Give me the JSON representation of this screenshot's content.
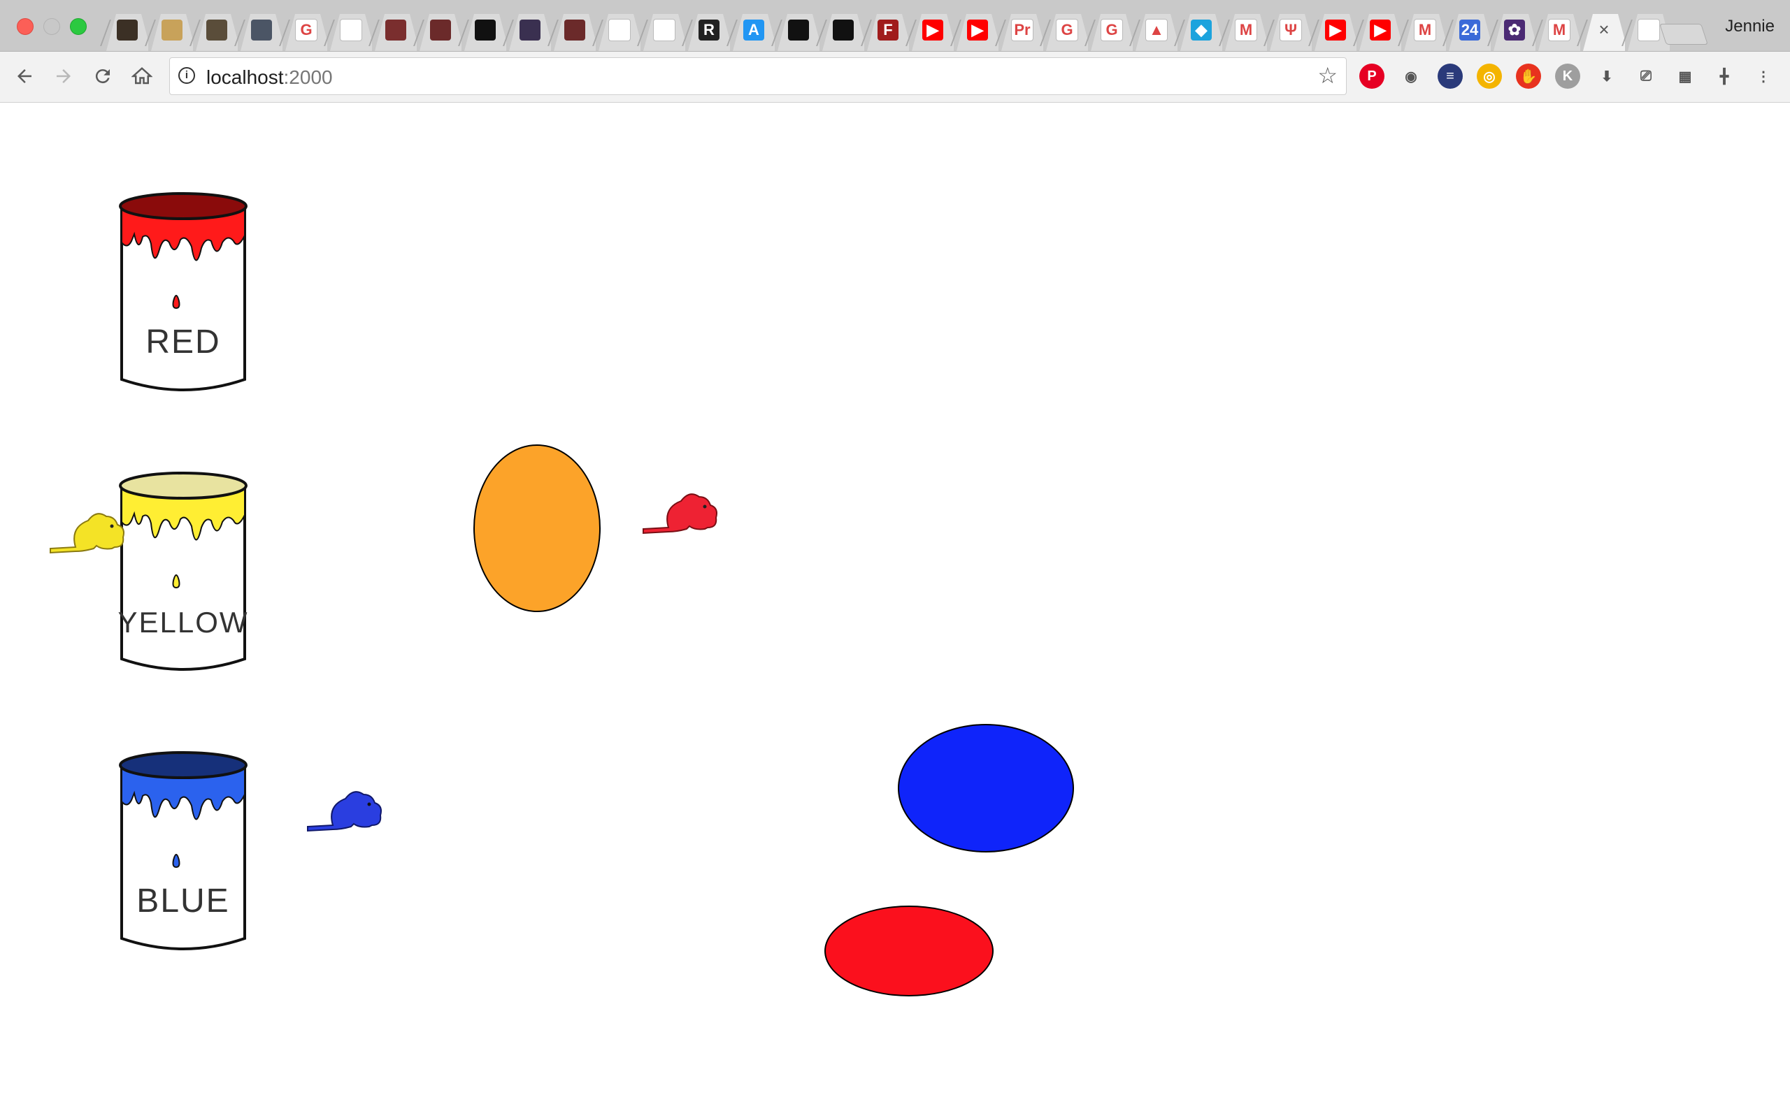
{
  "window": {
    "profile_name": "Jennie",
    "tabs": [
      {
        "icon": "dark-painting-favicon",
        "color": "#3b3025",
        "glyph": ""
      },
      {
        "icon": "feather-favicon",
        "color": "#c8a25a",
        "glyph": ""
      },
      {
        "icon": "painting-favicon",
        "color": "#5a4d3a",
        "glyph": ""
      },
      {
        "icon": "painting-favicon",
        "color": "#4b5565",
        "glyph": ""
      },
      {
        "icon": "google-icon",
        "color": "#ffffff",
        "glyph": "G"
      },
      {
        "icon": "document-icon",
        "color": "#ffffff",
        "glyph": ""
      },
      {
        "icon": "video-thumbnail-favicon",
        "color": "#7a2e2e",
        "glyph": ""
      },
      {
        "icon": "video-thumbnail-favicon",
        "color": "#6b2a2a",
        "glyph": ""
      },
      {
        "icon": "dark-image-favicon",
        "color": "#111111",
        "glyph": ""
      },
      {
        "icon": "figure-image-favicon",
        "color": "#3a3050",
        "glyph": ""
      },
      {
        "icon": "video-thumbnail-favicon",
        "color": "#6b2a2a",
        "glyph": ""
      },
      {
        "icon": "bar-chart-icon",
        "color": "#ffffff",
        "glyph": ""
      },
      {
        "icon": "document-icon",
        "color": "#ffffff",
        "glyph": ""
      },
      {
        "icon": "r-logo-icon",
        "color": "#222222",
        "glyph": "R"
      },
      {
        "icon": "letter-a-icon",
        "color": "#2196f3",
        "glyph": "A"
      },
      {
        "icon": "github-icon",
        "color": "#111111",
        "glyph": ""
      },
      {
        "icon": "github-icon",
        "color": "#111111",
        "glyph": ""
      },
      {
        "icon": "flash-icon",
        "color": "#a01c1c",
        "glyph": "F"
      },
      {
        "icon": "youtube-icon",
        "color": "#ff0000",
        "glyph": "▶"
      },
      {
        "icon": "youtube-icon",
        "color": "#ff0000",
        "glyph": "▶"
      },
      {
        "icon": "pr-text-icon",
        "color": "#ffffff",
        "glyph": "Pr"
      },
      {
        "icon": "google-icon",
        "color": "#ffffff",
        "glyph": "G"
      },
      {
        "icon": "google-icon",
        "color": "#ffffff",
        "glyph": "G"
      },
      {
        "icon": "google-drive-icon",
        "color": "#ffffff",
        "glyph": "▲"
      },
      {
        "icon": "cube-icon",
        "color": "#1ca3dd",
        "glyph": "◆"
      },
      {
        "icon": "gmail-icon",
        "color": "#ffffff",
        "glyph": "M"
      },
      {
        "icon": "laurel-icon",
        "color": "#ffffff",
        "glyph": "Ψ"
      },
      {
        "icon": "youtube-icon",
        "color": "#ff0000",
        "glyph": "▶"
      },
      {
        "icon": "youtube-icon",
        "color": "#ff0000",
        "glyph": "▶"
      },
      {
        "icon": "gmail-icon",
        "color": "#ffffff",
        "glyph": "M"
      },
      {
        "icon": "calendar-icon",
        "color": "#3b6ad8",
        "glyph": "24"
      },
      {
        "icon": "purple-flower-icon",
        "color": "#4b2a74",
        "glyph": "✿"
      },
      {
        "icon": "gmail-icon",
        "color": "#ffffff",
        "glyph": "M"
      },
      {
        "icon": "close-tab-icon",
        "color": "",
        "glyph": "×",
        "active": true
      },
      {
        "icon": "document-icon",
        "color": "#ffffff",
        "glyph": ""
      }
    ]
  },
  "toolbar": {
    "url_host": "localhost",
    "url_port": ":2000",
    "extensions": [
      {
        "icon": "pinterest-icon",
        "color": "#e60023",
        "glyph": "P"
      },
      {
        "icon": "eye-icon",
        "color": "#ffffff",
        "glyph": "◉"
      },
      {
        "icon": "flag-icon",
        "color": "#2a3a7a",
        "glyph": "≡"
      },
      {
        "icon": "colorful-circle-icon",
        "color": "#f4b400",
        "glyph": "◎"
      },
      {
        "icon": "stop-hand-icon",
        "color": "#e8321e",
        "glyph": "✋"
      },
      {
        "icon": "k-extension-icon",
        "color": "#9e9e9e",
        "glyph": "K"
      },
      {
        "icon": "download-arrow-icon",
        "color": "#ffffff",
        "glyph": "⬇"
      },
      {
        "icon": "cast-icon",
        "color": "#ffffff",
        "glyph": "⎚"
      },
      {
        "icon": "grid-icon",
        "color": "#ffffff",
        "glyph": "▦"
      },
      {
        "icon": "crosshair-icon",
        "color": "#ffffff",
        "glyph": "╋"
      },
      {
        "icon": "menu-dots-icon",
        "color": "#ffffff",
        "glyph": "⋮"
      }
    ]
  },
  "scene": {
    "cans": [
      {
        "label": "RED",
        "paint": "#ff1a1a",
        "rim": "#8a0b0b"
      },
      {
        "label": "YELLOW",
        "paint": "#ffee33",
        "rim": "#e8e3a0"
      },
      {
        "label": "BLUE",
        "paint": "#2b62ee",
        "rim": "#16307a"
      }
    ],
    "beavers": [
      {
        "name": "yellow-beaver",
        "color": "#f4e326"
      },
      {
        "name": "red-beaver",
        "color": "#ee2233"
      },
      {
        "name": "blue-beaver",
        "color": "#2a3ee0"
      }
    ],
    "blobs": [
      {
        "name": "orange-blob",
        "color": "#fca329"
      },
      {
        "name": "blue-blob",
        "color": "#0f24fa"
      },
      {
        "name": "red-blob",
        "color": "#fb101d"
      }
    ]
  }
}
